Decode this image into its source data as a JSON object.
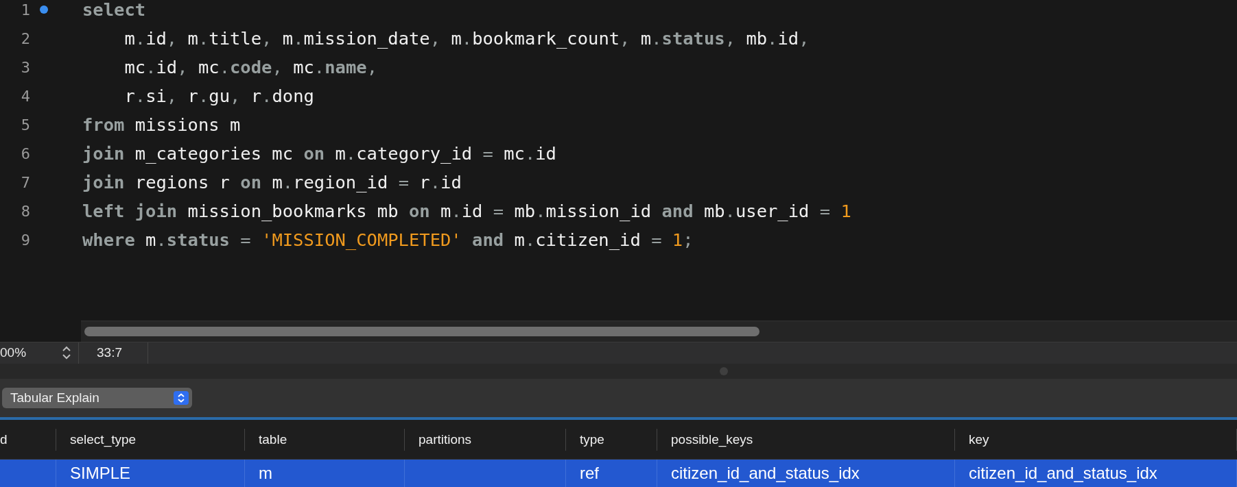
{
  "editor": {
    "lines": [
      {
        "number": "1",
        "bookmarked": true,
        "tokens": [
          {
            "kind": "kw",
            "text": "select"
          }
        ]
      },
      {
        "number": "2",
        "bookmarked": false,
        "tokens": [
          {
            "kind": "id",
            "text": "    m"
          },
          {
            "kind": "p",
            "text": "."
          },
          {
            "kind": "id",
            "text": "id"
          },
          {
            "kind": "p",
            "text": ", "
          },
          {
            "kind": "id",
            "text": "m"
          },
          {
            "kind": "p",
            "text": "."
          },
          {
            "kind": "id",
            "text": "title"
          },
          {
            "kind": "p",
            "text": ", "
          },
          {
            "kind": "id",
            "text": "m"
          },
          {
            "kind": "p",
            "text": "."
          },
          {
            "kind": "id",
            "text": "mission_date"
          },
          {
            "kind": "p",
            "text": ", "
          },
          {
            "kind": "id",
            "text": "m"
          },
          {
            "kind": "p",
            "text": "."
          },
          {
            "kind": "id",
            "text": "bookmark_count"
          },
          {
            "kind": "p",
            "text": ", "
          },
          {
            "kind": "id",
            "text": "m"
          },
          {
            "kind": "p",
            "text": "."
          },
          {
            "kind": "kw",
            "text": "status"
          },
          {
            "kind": "p",
            "text": ", "
          },
          {
            "kind": "id",
            "text": "mb"
          },
          {
            "kind": "p",
            "text": "."
          },
          {
            "kind": "id",
            "text": "id"
          },
          {
            "kind": "p",
            "text": ","
          }
        ]
      },
      {
        "number": "3",
        "bookmarked": false,
        "tokens": [
          {
            "kind": "id",
            "text": "    mc"
          },
          {
            "kind": "p",
            "text": "."
          },
          {
            "kind": "id",
            "text": "id"
          },
          {
            "kind": "p",
            "text": ", "
          },
          {
            "kind": "id",
            "text": "mc"
          },
          {
            "kind": "p",
            "text": "."
          },
          {
            "kind": "kw",
            "text": "code"
          },
          {
            "kind": "p",
            "text": ", "
          },
          {
            "kind": "id",
            "text": "mc"
          },
          {
            "kind": "p",
            "text": "."
          },
          {
            "kind": "kw",
            "text": "name"
          },
          {
            "kind": "p",
            "text": ","
          }
        ]
      },
      {
        "number": "4",
        "bookmarked": false,
        "tokens": [
          {
            "kind": "id",
            "text": "    r"
          },
          {
            "kind": "p",
            "text": "."
          },
          {
            "kind": "id",
            "text": "si"
          },
          {
            "kind": "p",
            "text": ", "
          },
          {
            "kind": "id",
            "text": "r"
          },
          {
            "kind": "p",
            "text": "."
          },
          {
            "kind": "id",
            "text": "gu"
          },
          {
            "kind": "p",
            "text": ", "
          },
          {
            "kind": "id",
            "text": "r"
          },
          {
            "kind": "p",
            "text": "."
          },
          {
            "kind": "id",
            "text": "dong"
          }
        ]
      },
      {
        "number": "5",
        "bookmarked": false,
        "tokens": [
          {
            "kind": "kw",
            "text": "from"
          },
          {
            "kind": "id",
            "text": " missions m"
          }
        ]
      },
      {
        "number": "6",
        "bookmarked": false,
        "tokens": [
          {
            "kind": "kw",
            "text": "join"
          },
          {
            "kind": "id",
            "text": " m_categories mc "
          },
          {
            "kind": "kw",
            "text": "on"
          },
          {
            "kind": "id",
            "text": " m"
          },
          {
            "kind": "p",
            "text": "."
          },
          {
            "kind": "id",
            "text": "category_id "
          },
          {
            "kind": "p",
            "text": "="
          },
          {
            "kind": "id",
            "text": " mc"
          },
          {
            "kind": "p",
            "text": "."
          },
          {
            "kind": "id",
            "text": "id"
          }
        ]
      },
      {
        "number": "7",
        "bookmarked": false,
        "tokens": [
          {
            "kind": "kw",
            "text": "join"
          },
          {
            "kind": "id",
            "text": " regions r "
          },
          {
            "kind": "kw",
            "text": "on"
          },
          {
            "kind": "id",
            "text": " m"
          },
          {
            "kind": "p",
            "text": "."
          },
          {
            "kind": "id",
            "text": "region_id "
          },
          {
            "kind": "p",
            "text": "="
          },
          {
            "kind": "id",
            "text": " r"
          },
          {
            "kind": "p",
            "text": "."
          },
          {
            "kind": "id",
            "text": "id"
          }
        ]
      },
      {
        "number": "8",
        "bookmarked": false,
        "tokens": [
          {
            "kind": "kw",
            "text": "left join"
          },
          {
            "kind": "id",
            "text": " mission_bookmarks mb "
          },
          {
            "kind": "kw",
            "text": "on"
          },
          {
            "kind": "id",
            "text": " m"
          },
          {
            "kind": "p",
            "text": "."
          },
          {
            "kind": "id",
            "text": "id "
          },
          {
            "kind": "p",
            "text": "="
          },
          {
            "kind": "id",
            "text": " mb"
          },
          {
            "kind": "p",
            "text": "."
          },
          {
            "kind": "id",
            "text": "mission_id "
          },
          {
            "kind": "kw",
            "text": "and"
          },
          {
            "kind": "id",
            "text": " mb"
          },
          {
            "kind": "p",
            "text": "."
          },
          {
            "kind": "id",
            "text": "user_id "
          },
          {
            "kind": "p",
            "text": "="
          },
          {
            "kind": "lit",
            "text": " 1"
          }
        ]
      },
      {
        "number": "9",
        "bookmarked": false,
        "tokens": [
          {
            "kind": "kw",
            "text": "where"
          },
          {
            "kind": "id",
            "text": " m"
          },
          {
            "kind": "p",
            "text": "."
          },
          {
            "kind": "kw",
            "text": "status"
          },
          {
            "kind": "p",
            "text": " = "
          },
          {
            "kind": "lit",
            "text": "'MISSION_COMPLETED'"
          },
          {
            "kind": "kw",
            "text": " and"
          },
          {
            "kind": "id",
            "text": " m"
          },
          {
            "kind": "p",
            "text": "."
          },
          {
            "kind": "id",
            "text": "citizen_id "
          },
          {
            "kind": "p",
            "text": "="
          },
          {
            "kind": "lit",
            "text": " 1"
          },
          {
            "kind": "p",
            "text": ";"
          }
        ]
      }
    ]
  },
  "status_bar": {
    "zoom": "00%",
    "cursor": "33:7"
  },
  "explain_mode": {
    "value": "Tabular Explain"
  },
  "table": {
    "columns": [
      "d",
      "select_type",
      "table",
      "partitions",
      "type",
      "possible_keys",
      "key"
    ],
    "rows": [
      {
        "selected": true,
        "cells": [
          null,
          "SIMPLE",
          "m",
          null,
          "ref",
          "citizen_id_and_status_idx",
          "citizen_id_and_status_idx"
        ]
      }
    ]
  }
}
